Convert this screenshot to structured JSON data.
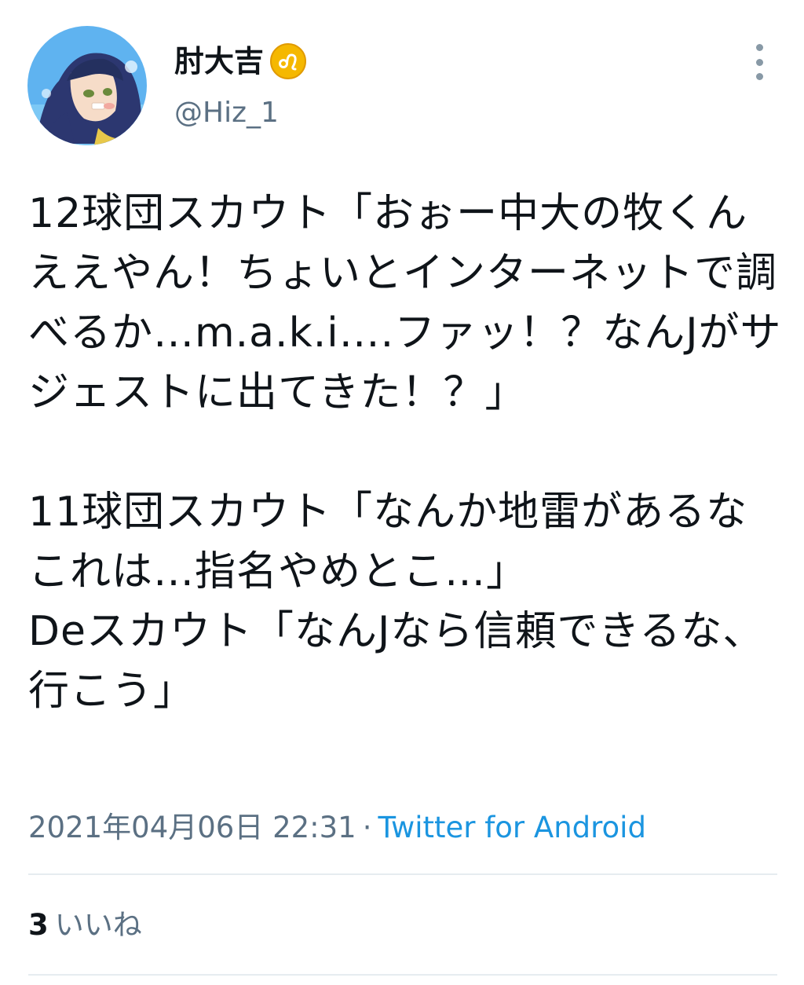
{
  "user": {
    "display_name": "肘大吉",
    "badge_icon": "leo-zodiac-icon",
    "handle": "@Hiz_1",
    "avatar": "anime-character-avatar"
  },
  "tweet": {
    "text": "12球団スカウト「おぉー中大の牧くんええやん！ちょいとインターネットで調べるか…m.a.k.i….ファッ！？なんJがサジェストに出てきた！？」\n\n11球団スカウト「なんか地雷があるなこれは…指名やめとこ…」\nDeスカウト「なんJなら信頼できるな、行こう」",
    "timestamp": "2021年04月06日 22:31",
    "separator": "·",
    "client": "Twitter for Android"
  },
  "stats": {
    "likes_count": "3",
    "likes_label": "いいね"
  },
  "icons": {
    "more": "more-vertical-icon"
  },
  "colors": {
    "text_primary": "#0f1419",
    "text_secondary": "#5b7083",
    "link": "#1b95e0",
    "divider": "#e6ecf0",
    "badge": "#f5b800"
  }
}
